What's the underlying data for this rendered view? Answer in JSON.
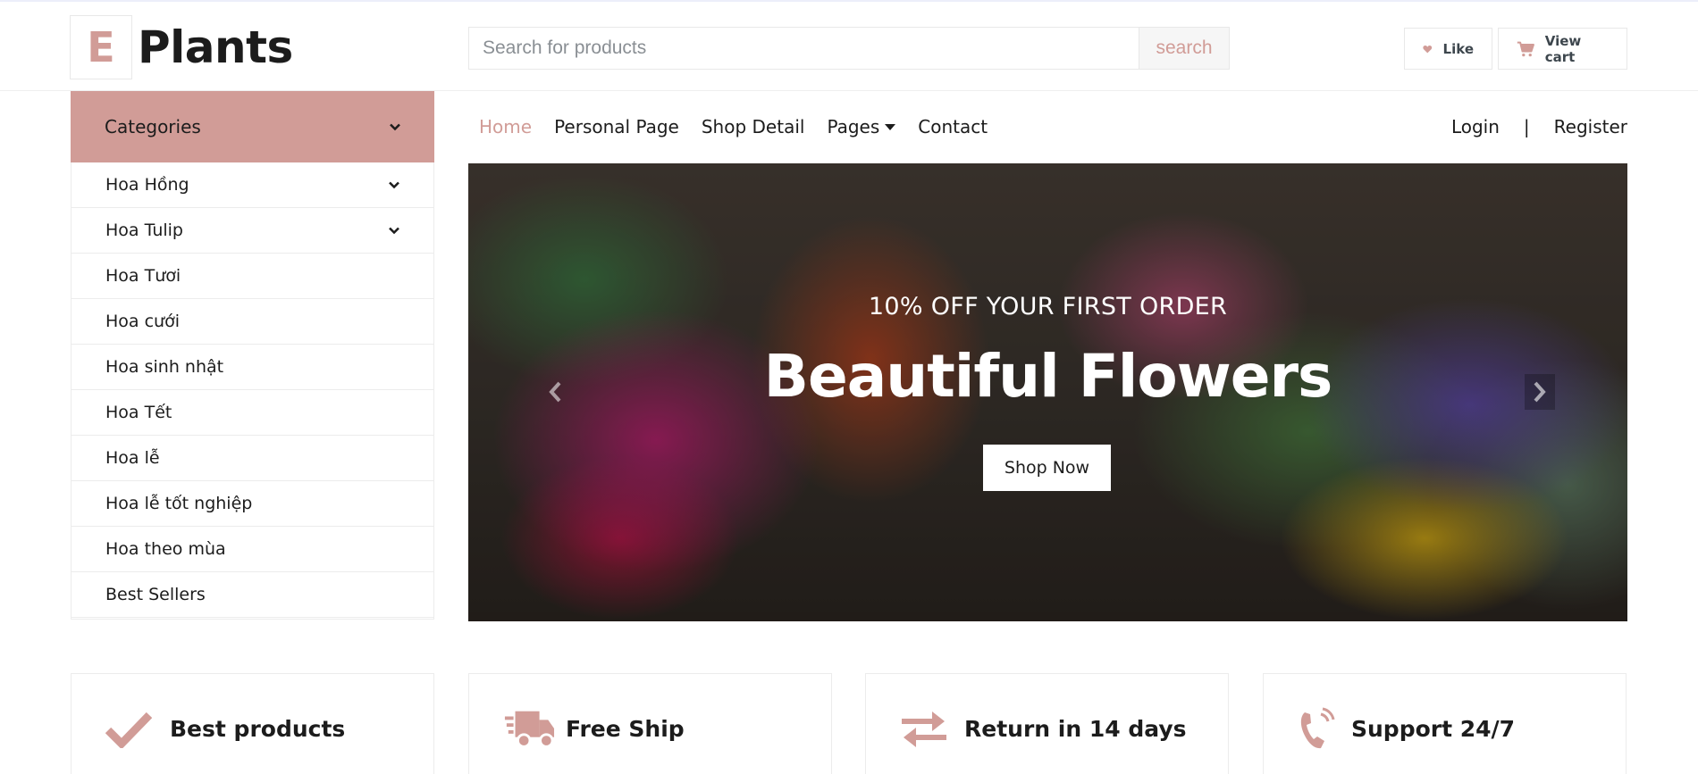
{
  "colors": {
    "accent": "#d19c97",
    "text": "#1c1c1c",
    "border": "#ececec"
  },
  "header": {
    "logo_letter": "E",
    "logo_text": "Plants",
    "search_placeholder": "Search for products",
    "search_button": "search",
    "like_label": "Like",
    "cart_label": "View cart"
  },
  "sidebar": {
    "title": "Categories",
    "items": [
      {
        "label": "Hoa Hồng",
        "has_submenu": true
      },
      {
        "label": "Hoa Tulip",
        "has_submenu": true
      },
      {
        "label": "Hoa Tươi"
      },
      {
        "label": "Hoa cưới"
      },
      {
        "label": "Hoa sinh nhật"
      },
      {
        "label": "Hoa Tết"
      },
      {
        "label": "Hoa lễ"
      },
      {
        "label": "Hoa lễ tốt nghiệp"
      },
      {
        "label": "Hoa theo mùa"
      },
      {
        "label": "Best Sellers"
      }
    ]
  },
  "nav": {
    "links": [
      "Home",
      "Personal Page",
      "Shop Detail",
      "Pages",
      "Contact"
    ],
    "login": "Login",
    "separator": "|",
    "register": "Register"
  },
  "hero": {
    "subtitle": "10% OFF YOUR FIRST ORDER",
    "title": "Beautiful Flowers",
    "button": "Shop Now"
  },
  "features": [
    {
      "icon": "check-icon",
      "label": "Best products"
    },
    {
      "icon": "truck-icon",
      "label": "Free Ship"
    },
    {
      "icon": "exchange-icon",
      "label": "Return in 14 days"
    },
    {
      "icon": "phone-icon",
      "label": "Support 24/7"
    }
  ]
}
